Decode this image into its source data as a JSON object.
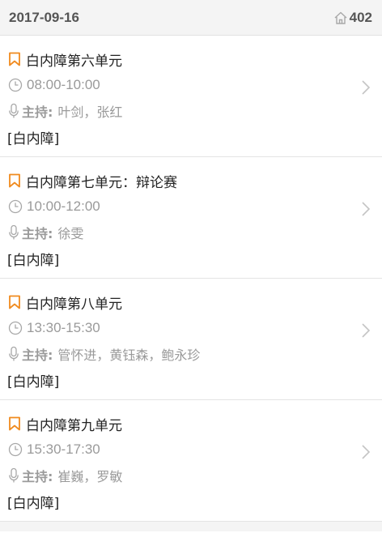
{
  "header": {
    "date": "2017-09-16",
    "room": "402"
  },
  "sessions": [
    {
      "title": "白内障第六单元",
      "time": "08:00-10:00",
      "host_label": "主持:",
      "hosts": "叶剑，张红",
      "tag": "[白内障]"
    },
    {
      "title": "白内障第七单元：辩论赛",
      "time": "10:00-12:00",
      "host_label": "主持:",
      "hosts": "徐雯",
      "tag": "[白内障]"
    },
    {
      "title": "白内障第八单元",
      "time": "13:30-15:30",
      "host_label": "主持:",
      "hosts": "管怀进，黄钰森，鲍永珍",
      "tag": "[白内障]"
    },
    {
      "title": "白内障第九单元",
      "time": "15:30-17:30",
      "host_label": "主持:",
      "hosts": "崔巍，罗敏",
      "tag": "[白内障]"
    }
  ],
  "icons": {
    "bookmark": "bookmark-icon",
    "clock": "clock-icon",
    "microphone": "microphone-icon",
    "home": "home-icon",
    "chevron": "chevron-right-icon"
  },
  "colors": {
    "accent": "#f08a1e",
    "muted": "#9a9a9a",
    "header_bg": "#f4f4f4"
  }
}
